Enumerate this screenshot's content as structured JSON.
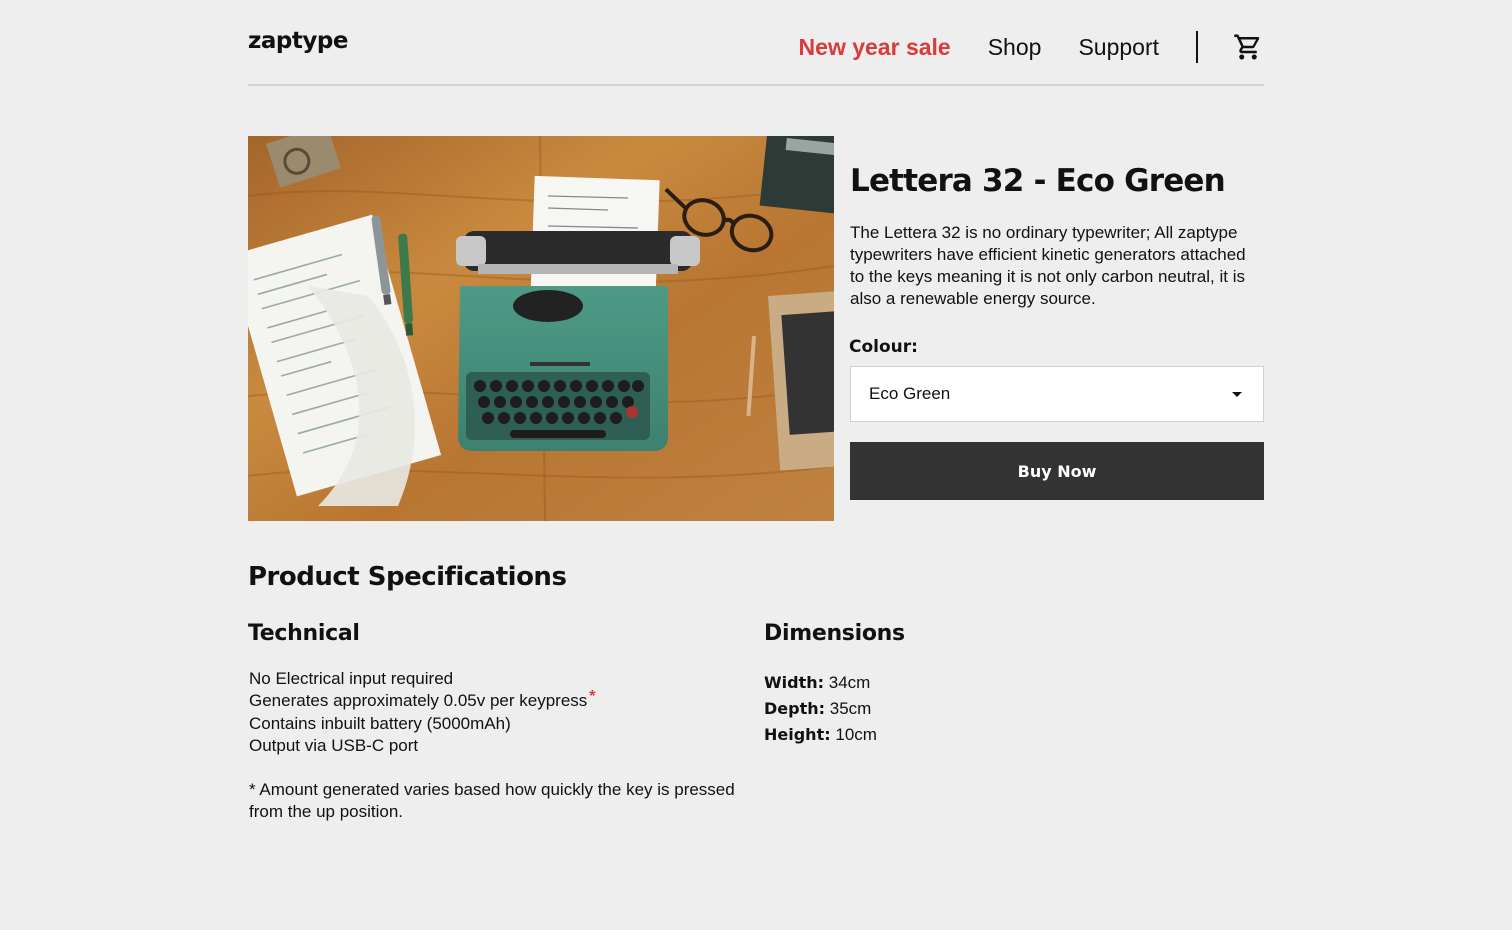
{
  "header": {
    "logo": "zaptype",
    "nav": [
      {
        "label": "New year sale"
      },
      {
        "label": "Shop"
      },
      {
        "label": "Support"
      }
    ],
    "cart_icon": "cart-icon"
  },
  "product": {
    "image_icon": "typewriter-photo",
    "title": "Lettera 32 - Eco Green",
    "description": "The Lettera 32 is no ordinary typewriter; All zaptype typewriters have efficient kinetic generators attached to the keys meaning it is not only carbon neutral, it is also a renewable energy source.",
    "colour_label": "Colour:",
    "colour_selected": "Eco Green",
    "buy_label": "Buy Now"
  },
  "specs": {
    "title": "Product Specifications",
    "technical": {
      "heading": "Technical",
      "items": [
        "No Electrical input required",
        "Generates approximately 0.05v per keypress",
        "Contains inbuilt battery (5000mAh)",
        "Output via USB-C port"
      ],
      "star": "*",
      "footnote": "* Amount generated varies based how quickly the key is pressed from the up position."
    },
    "dimensions": {
      "heading": "Dimensions",
      "items": [
        {
          "label": "Width:",
          "value": "34cm"
        },
        {
          "label": "Depth:",
          "value": "35cm"
        },
        {
          "label": "Height:",
          "value": "10cm"
        }
      ]
    }
  },
  "colors": {
    "background": "#eeeeee",
    "sale": "#d93a3a",
    "button": "#333333"
  }
}
